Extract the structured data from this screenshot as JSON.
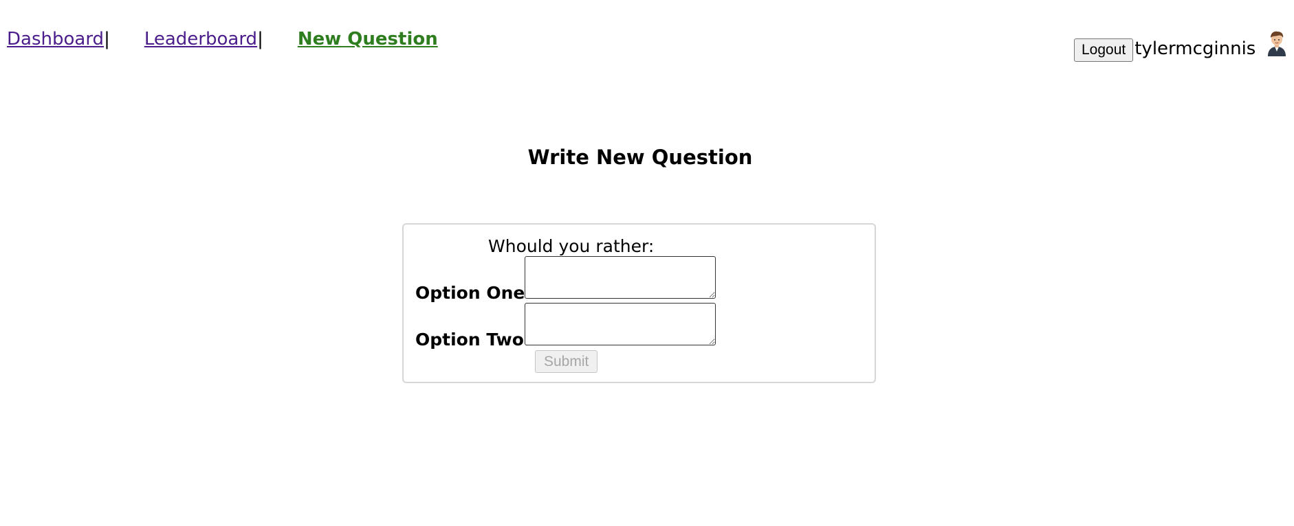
{
  "nav": {
    "links": [
      {
        "label": "Dashboard"
      },
      {
        "label": "Leaderboard"
      },
      {
        "label": "New Question"
      }
    ],
    "separator": "|"
  },
  "user": {
    "logout_label": "Logout",
    "username": "tylermcginnis",
    "avatar_icon": "avatar-icon"
  },
  "page": {
    "title": "Write New Question"
  },
  "form": {
    "prompt": "Whould you rather:",
    "option_one_label": "Option One:",
    "option_one_value": "",
    "option_two_label": "Option Two:",
    "option_two_value": "",
    "submit_label": "Submit"
  },
  "colors": {
    "link": "#4b1d8c",
    "active_link": "#2e7d1f",
    "card_border": "#d6d6d6",
    "disabled_text": "#a6a6a6"
  }
}
